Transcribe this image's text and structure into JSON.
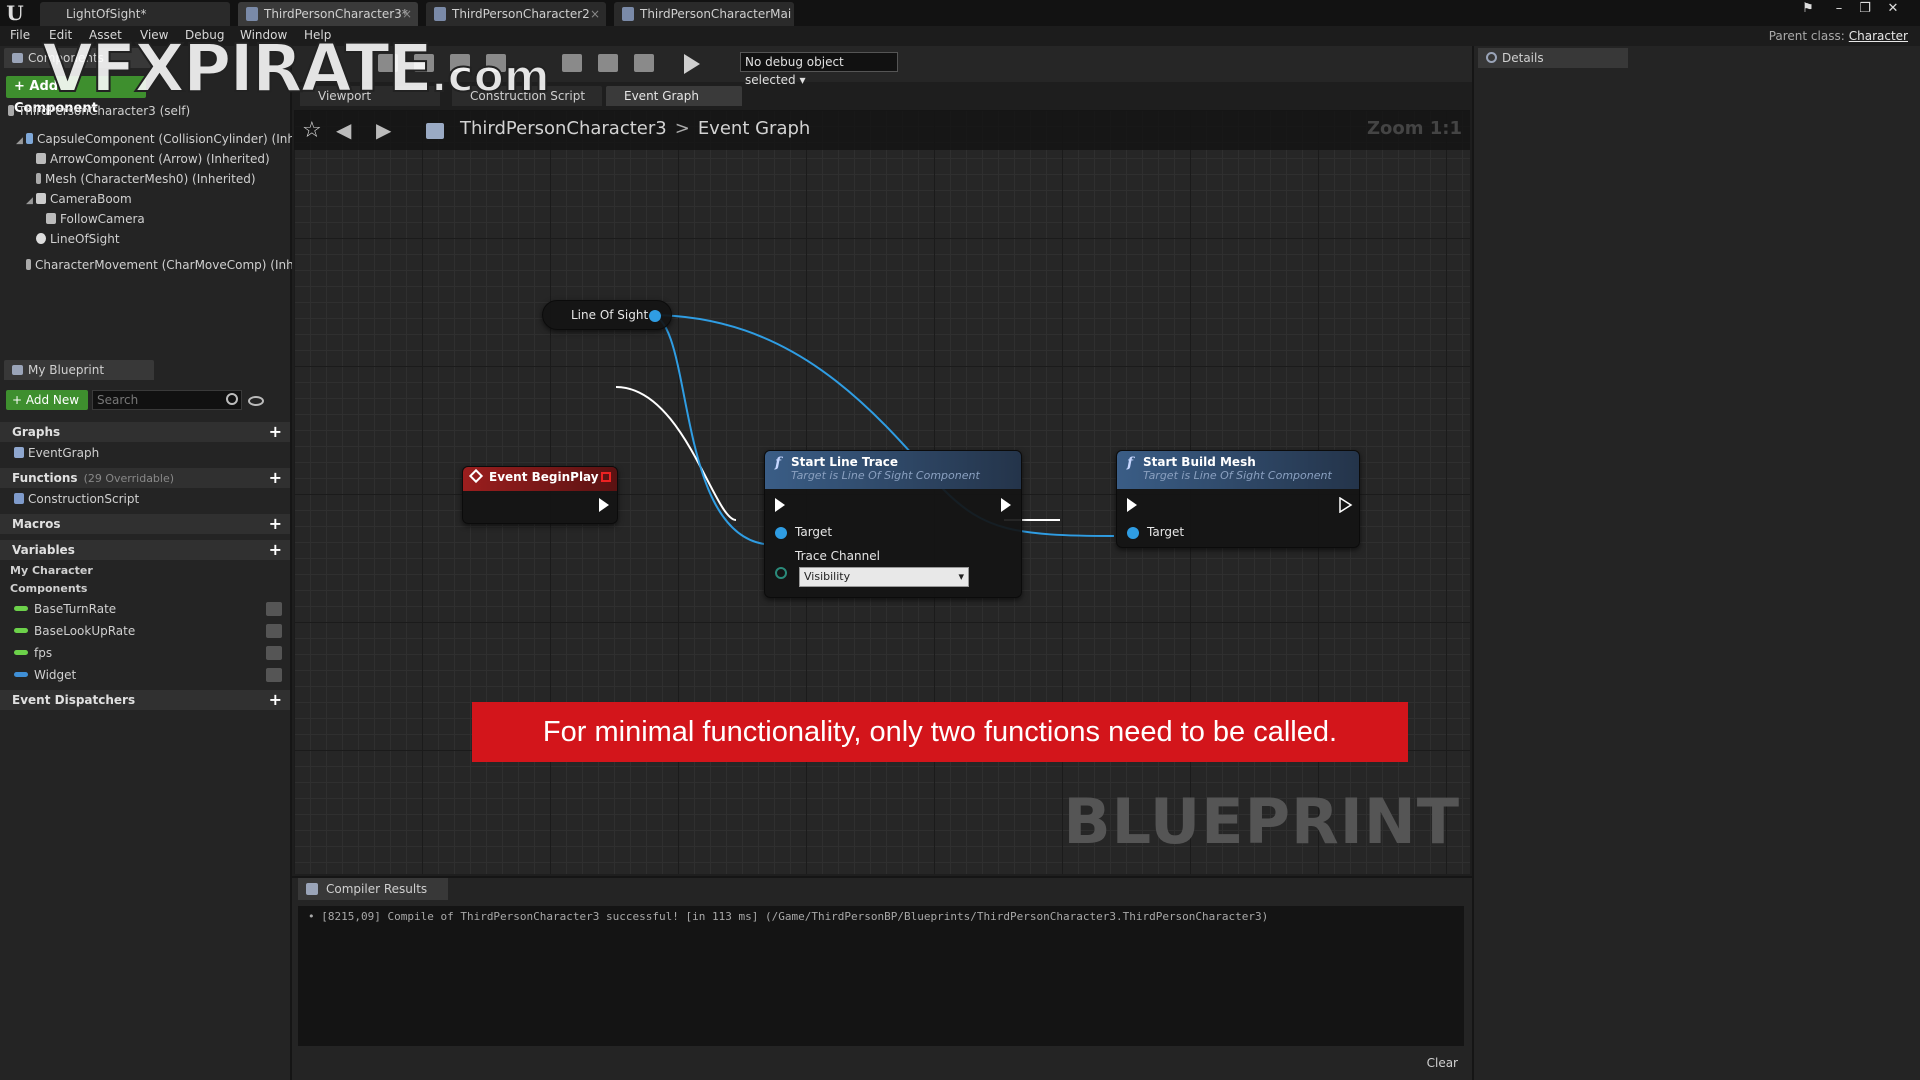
{
  "titlebar": {
    "tabs": [
      {
        "label": "LightOfSight*"
      },
      {
        "label": "ThirdPersonCharacter3*"
      },
      {
        "label": "ThirdPersonCharacter2"
      },
      {
        "label": "ThirdPersonCharacterMai"
      }
    ]
  },
  "menubar": {
    "items": [
      "File",
      "Edit",
      "Asset",
      "View",
      "Debug",
      "Window",
      "Help"
    ],
    "parent_class_label": "Parent class:",
    "parent_class_value": "Character"
  },
  "components": {
    "tab_label": "Components",
    "add_button": "+ Add Component",
    "self_label": "ThirdPersonCharacter3 (self)",
    "tree": [
      {
        "label": "CapsuleComponent (CollisionCylinder) (Inhe"
      },
      {
        "label": "ArrowComponent (Arrow) (Inherited)"
      },
      {
        "label": "Mesh (CharacterMesh0) (Inherited)"
      },
      {
        "label": "CameraBoom"
      },
      {
        "label": "FollowCamera"
      },
      {
        "label": "LineOfSight"
      },
      {
        "label": "CharacterMovement (CharMoveComp) (Inher"
      }
    ]
  },
  "my_blueprint": {
    "tab_label": "My Blueprint",
    "add_new": "+ Add New",
    "search_placeholder": "Search",
    "sections": {
      "graphs": "Graphs",
      "graphs_item": "EventGraph",
      "functions": "Functions",
      "functions_sub": "(29 Overridable)",
      "functions_item": "ConstructionScript",
      "macros": "Macros",
      "variables": "Variables",
      "my_character": "My Character",
      "components_cat": "Components",
      "event_dispatchers": "Event Dispatchers"
    },
    "variables": [
      {
        "label": "BaseTurnRate",
        "color": "#6cd14a"
      },
      {
        "label": "BaseLookUpRate",
        "color": "#6cd14a"
      },
      {
        "label": "fps",
        "color": "#6cd14a"
      },
      {
        "label": "Widget",
        "color": "#3f8fd6"
      }
    ]
  },
  "toolbar": {
    "debug_dropdown": "No debug object selected"
  },
  "editor_tabs": {
    "viewport": "Viewport",
    "construction": "Construction Script",
    "event_graph": "Event Graph"
  },
  "graph": {
    "breadcrumb_root": "ThirdPersonCharacter3",
    "breadcrumb_sep": ">",
    "breadcrumb_leaf": "Event Graph",
    "zoom": "Zoom 1:1",
    "watermark": "BLUEPRINT",
    "nodes": {
      "line_of_sight": {
        "title": "Line Of Sight"
      },
      "begin_play": {
        "title": "Event BeginPlay"
      },
      "start_line_trace": {
        "title": "Start Line Trace",
        "subtitle": "Target is Line Of Sight Component",
        "target_label": "Target",
        "trace_label": "Trace Channel",
        "trace_value": "Visibility"
      },
      "start_build_mesh": {
        "title": "Start Build Mesh",
        "subtitle": "Target is Line Of Sight Component",
        "target_label": "Target"
      }
    },
    "banner": "For minimal functionality, only two functions need to be called."
  },
  "compiler": {
    "tab_label": "Compiler Results",
    "log": "[8215,09] Compile of ThirdPersonCharacter3 successful! [in 113 ms] (/Game/ThirdPersonBP/Blueprints/ThirdPersonCharacter3.ThirdPersonCharacter3)",
    "clear": "Clear"
  },
  "details": {
    "tab_label": "Details"
  },
  "watermark": {
    "brand": "VFXPIRATE",
    "suffix": ".com"
  },
  "colors": {
    "accent_green": "#3e8f2e",
    "pin_blue": "#2f9de3",
    "event_red": "#a02222",
    "function_blue": "#3a5d86",
    "banner_red": "#d3151b"
  }
}
